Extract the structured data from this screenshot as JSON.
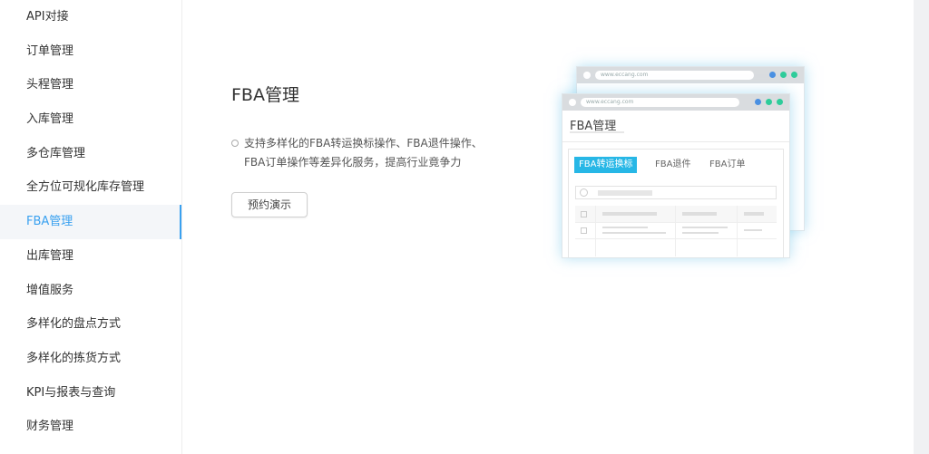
{
  "sidebar": {
    "items": [
      {
        "label": "API对接"
      },
      {
        "label": "订单管理"
      },
      {
        "label": "头程管理"
      },
      {
        "label": "入库管理"
      },
      {
        "label": "多仓库管理"
      },
      {
        "label": "全方位可规化库存管理"
      },
      {
        "label": "FBA管理",
        "active": true
      },
      {
        "label": "出库管理"
      },
      {
        "label": "增值服务"
      },
      {
        "label": "多样化的盘点方式"
      },
      {
        "label": "多样化的拣货方式"
      },
      {
        "label": "KPI与报表与查询"
      },
      {
        "label": "财务管理"
      }
    ]
  },
  "main": {
    "title": "FBA管理",
    "description": "支持多样化的FBA转运换标操作、FBA退件操作、FBA订单操作等差异化服务，提高行业竟争力",
    "demo_button": "预约演示"
  },
  "illustration": {
    "back_url": "www.eccang.com",
    "front_url": "www.eccang.com",
    "window_title": "FBA管理",
    "tabs": [
      "FBA转运换标",
      "FBA退件",
      "FBA订单"
    ],
    "active_tab": 0
  },
  "colors": {
    "accent": "#3aa1f0",
    "tab_active": "#27b7e6",
    "dot_blue": "#4a90e2",
    "dot_green": "#2ecc9a"
  }
}
